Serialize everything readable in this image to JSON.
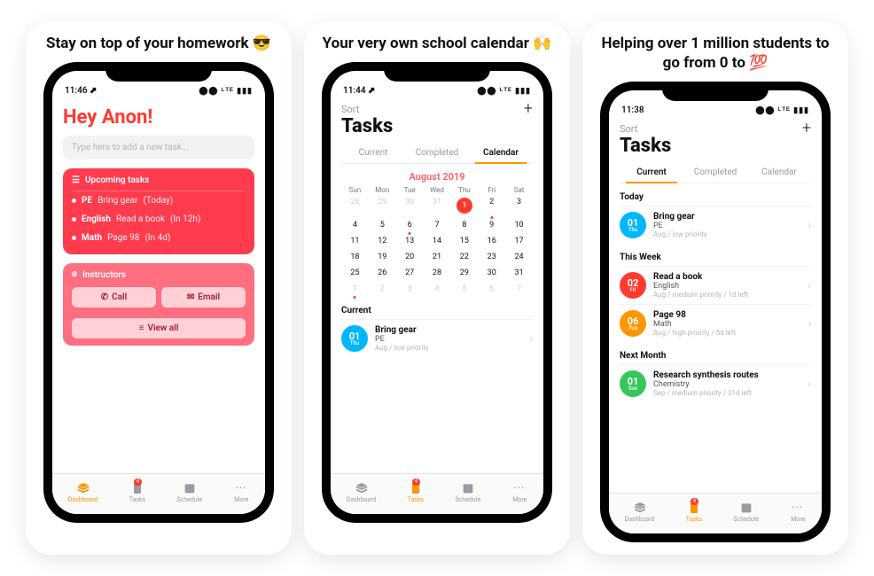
{
  "screens": [
    {
      "headline": "Stay on top of your homework 😎",
      "status": {
        "time": "11:46 ⬈",
        "signal": "⬤⬤ ᴸᵀᴱ ▮▮▮"
      },
      "greeting": "Hey Anon!",
      "task_input_placeholder": "Type here to add a new task...",
      "upcoming": {
        "title": "Upcoming tasks",
        "items": [
          {
            "subject": "PE",
            "text": "Bring gear",
            "meta": "(Today)"
          },
          {
            "subject": "English",
            "text": "Read a book",
            "meta": "(In 12h)"
          },
          {
            "subject": "Math",
            "text": "Page 98",
            "meta": "(In 4d)"
          }
        ]
      },
      "instructors": {
        "title": "Instructors",
        "call": "Call",
        "email": "Email",
        "viewall": "View all"
      },
      "tabs": {
        "dashboard": "Dashboard",
        "tasks": "Tasks",
        "schedule": "Schedule",
        "more": "More",
        "badge": "4",
        "active": "dashboard"
      }
    },
    {
      "headline": "Your very own school calendar 🙌",
      "status": {
        "time": "11:44 ⬈",
        "signal": "⬤⬤ ᴸᵀᴱ ▮▮▮"
      },
      "sort": "Sort",
      "title": "Tasks",
      "subtabs": [
        "Current",
        "Completed",
        "Calendar"
      ],
      "active_subtab": 2,
      "month": "August 2019",
      "dow": [
        "Sun",
        "Mon",
        "Tue",
        "Wed",
        "Thu",
        "Fri",
        "Sat"
      ],
      "days": [
        {
          "n": "28",
          "dim": true
        },
        {
          "n": "29",
          "dim": true
        },
        {
          "n": "30",
          "dim": true
        },
        {
          "n": "31",
          "dim": true
        },
        {
          "n": "1",
          "sel": true
        },
        {
          "n": "2",
          "dot": true
        },
        {
          "n": "3"
        },
        {
          "n": "4"
        },
        {
          "n": "5"
        },
        {
          "n": "6",
          "dot": true
        },
        {
          "n": "7"
        },
        {
          "n": "8"
        },
        {
          "n": "9"
        },
        {
          "n": "10"
        },
        {
          "n": "11"
        },
        {
          "n": "12"
        },
        {
          "n": "13"
        },
        {
          "n": "14"
        },
        {
          "n": "15"
        },
        {
          "n": "16"
        },
        {
          "n": "17"
        },
        {
          "n": "18"
        },
        {
          "n": "19"
        },
        {
          "n": "20"
        },
        {
          "n": "21"
        },
        {
          "n": "22"
        },
        {
          "n": "23"
        },
        {
          "n": "24"
        },
        {
          "n": "25"
        },
        {
          "n": "26"
        },
        {
          "n": "27"
        },
        {
          "n": "28"
        },
        {
          "n": "29"
        },
        {
          "n": "30"
        },
        {
          "n": "31"
        },
        {
          "n": "1",
          "dim": true,
          "dot": true
        },
        {
          "n": "2",
          "dim": true
        },
        {
          "n": "3",
          "dim": true
        },
        {
          "n": "4",
          "dim": true
        },
        {
          "n": "5",
          "dim": true
        },
        {
          "n": "6",
          "dim": true
        },
        {
          "n": "7",
          "dim": true
        }
      ],
      "current_label": "Current",
      "current_task": {
        "day": "01",
        "dayLabel": "Thu",
        "title": "Bring gear",
        "sub": "PE",
        "meta": "Aug / low priority",
        "color": "blue"
      },
      "tabs": {
        "dashboard": "Dashboard",
        "tasks": "Tasks",
        "schedule": "Schedule",
        "more": "More",
        "badge": "4",
        "active": "tasks"
      }
    },
    {
      "headline": "Helping over 1 million students to go from 0 to 💯",
      "status": {
        "time": "11:38",
        "signal": "⬤⬤ ᴸᵀᴱ ▮▮▮"
      },
      "sort": "Sort",
      "title": "Tasks",
      "subtabs": [
        "Current",
        "Completed",
        "Calendar"
      ],
      "active_subtab": 0,
      "sections": [
        {
          "label": "Today",
          "items": [
            {
              "day": "01",
              "dayLabel": "Thu",
              "title": "Bring gear",
              "sub": "PE",
              "meta": "Aug / low priority",
              "color": "blue"
            }
          ]
        },
        {
          "label": "This Week",
          "items": [
            {
              "day": "02",
              "dayLabel": "Fri",
              "title": "Read a book",
              "sub": "English",
              "meta": "Aug / medium priority / 1d left",
              "color": "redc"
            },
            {
              "day": "06",
              "dayLabel": "Tue",
              "title": "Page 98",
              "sub": "Math",
              "meta": "Aug / high priority / 5d left",
              "color": "orangec"
            }
          ]
        },
        {
          "label": "Next Month",
          "items": [
            {
              "day": "01",
              "dayLabel": "Sun",
              "title": "Research synthesis routes",
              "sub": "Chemistry",
              "meta": "Sep / medium priority / 31d left",
              "color": "greenc"
            }
          ]
        }
      ],
      "tabs": {
        "dashboard": "Dashboard",
        "tasks": "Tasks",
        "schedule": "Schedule",
        "more": "More",
        "badge": "4",
        "active": "tasks"
      }
    }
  ]
}
